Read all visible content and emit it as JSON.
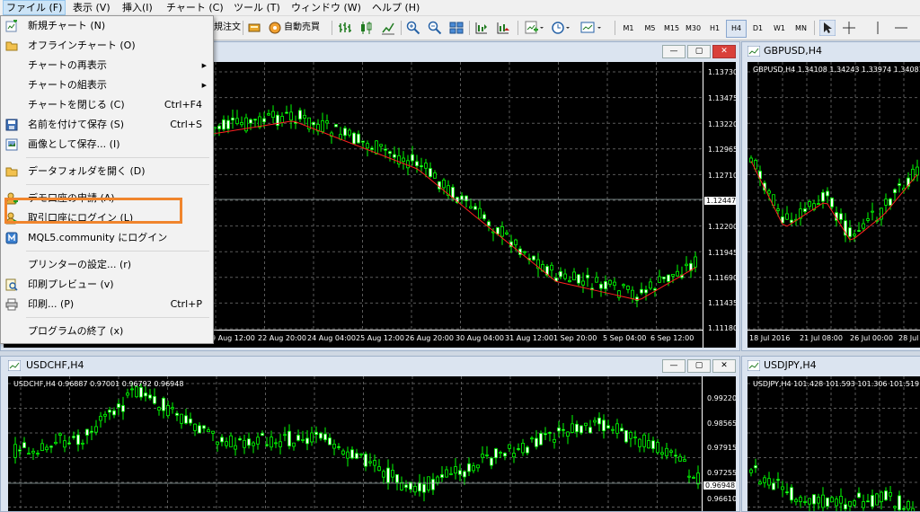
{
  "menu": [
    "ファイル (F)",
    "表示 (V)",
    "挿入(I)",
    "チャート (C)",
    "ツール (T)",
    "ウィンドウ (W)",
    "ヘルプ (H)"
  ],
  "toolbar": {
    "order_label": "規注文",
    "auto_trade_label": "自動売買",
    "timeframes": [
      "M1",
      "M5",
      "M15",
      "M30",
      "H1",
      "H4",
      "D1",
      "W1",
      "MN"
    ],
    "active_timeframe": "H4"
  },
  "file_menu": {
    "items": [
      {
        "label": "新規チャート (N)",
        "icon": "new-chart-icon"
      },
      {
        "label": "オフラインチャート (O)",
        "icon": "folder-icon"
      },
      {
        "label": "チャートの再表示",
        "submenu": true
      },
      {
        "label": "チャートの組表示",
        "submenu": true
      },
      {
        "label": "チャートを閉じる (C)",
        "shortcut": "Ctrl+F4"
      },
      {
        "label": "名前を付けて保存 (S)",
        "shortcut": "Ctrl+S",
        "icon": "save-icon"
      },
      {
        "label": "画像として保存... (I)",
        "icon": "picture-icon"
      },
      {
        "label": "データフォルダを開く (D)",
        "icon": "folder-icon"
      },
      {
        "label": "デモ口座の申請 (A)",
        "icon": "demo-account-icon",
        "highlighted": true
      },
      {
        "label": "取引口座にログイン (L)",
        "icon": "login-icon"
      },
      {
        "label": "MQL5.community にログイン",
        "icon": "mql5-icon"
      },
      {
        "label": "プリンターの設定... (r)"
      },
      {
        "label": "印刷プレビュー (v)",
        "icon": "print-preview-icon"
      },
      {
        "label": "印刷... (P)",
        "shortcut": "Ctrl+P",
        "icon": "printer-icon"
      },
      {
        "label": "プログラムの終了 (x)"
      }
    ]
  },
  "colors": {
    "highlight": "#f0852d",
    "bull": "#00ff00",
    "ma": "#ff0000",
    "chart_bg": "#000000"
  },
  "windows": {
    "eurusd": {
      "price_axis": [
        "1.13730",
        "1.13475",
        "1.13220",
        "1.12965",
        "1.12710",
        "1.12447",
        "1.12200",
        "1.11945",
        "1.11690",
        "1.11435",
        "1.11180"
      ],
      "current_price": "1.12447",
      "time_axis": [
        "9 Aug 12:00",
        "22 Aug 20:00",
        "24 Aug 04:00",
        "25 Aug 12:00",
        "26 Aug 20:00",
        "30 Aug 04:00",
        "31 Aug 12:00",
        "1 Sep 20:00",
        "5 Sep 04:00",
        "6 Sep 12:00"
      ]
    },
    "gbpusd": {
      "title": "GBPUSD,H4",
      "ohlc": "GBPUSD,H4  1.34108 1.34243 1.33974 1.34081",
      "time_axis": [
        "18 Jul 2016",
        "21 Jul 08:00",
        "26 Jul 00:00",
        "28 Jul 1"
      ]
    },
    "usdchf": {
      "title": "USDCHF,H4",
      "ohlc": "USDCHF,H4  0.96887 0.97001 0.96792 0.96948",
      "price_axis": [
        "0.99220",
        "0.98565",
        "0.97915",
        "0.97255",
        "0.96948",
        "0.96610"
      ],
      "current_price": "0.96948"
    },
    "usdjpy": {
      "title": "USDJPY,H4",
      "ohlc": "USDJPY,H4  101.428 101.593 101.306 101.519"
    }
  }
}
